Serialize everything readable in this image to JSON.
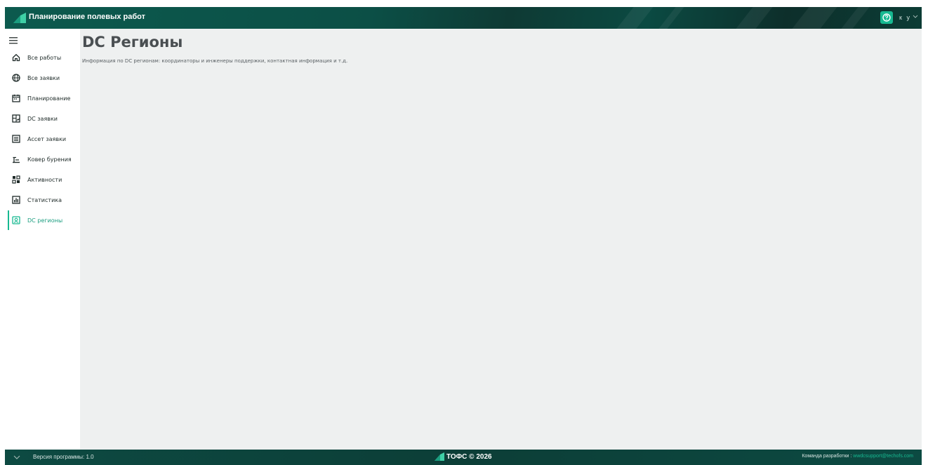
{
  "header": {
    "app_title": "Планирование полевых работ",
    "user_initials": "к у",
    "help_icon": "help-circle-icon",
    "brand_color": "#0c4f46",
    "accent_color": "#17b991"
  },
  "sidebar": {
    "menu_icon": "hamburger-icon",
    "items": [
      {
        "label": "Все работы",
        "icon": "home-icon"
      },
      {
        "label": "Все заявки",
        "icon": "globe-icon"
      },
      {
        "label": "Планирование",
        "icon": "calendar-icon"
      },
      {
        "label": "DC заявки",
        "icon": "chart-box-icon"
      },
      {
        "label": "Ассет заявки",
        "icon": "list-box-icon"
      },
      {
        "label": "Ковер бурения",
        "icon": "drill-icon"
      },
      {
        "label": "Активности",
        "icon": "grid-icon"
      },
      {
        "label": "Статистика",
        "icon": "bar-chart-icon"
      },
      {
        "label": "DC регионы",
        "icon": "region-icon",
        "active": true
      }
    ]
  },
  "main": {
    "title": "DC Регионы",
    "description": "Информация по DC регионам: координаторы и инженеры поддержки, контактная информация и т.д."
  },
  "footer": {
    "version": "Версия программы: 1.0",
    "brand": "ТОФС © 2026",
    "dev_team_label": "Команда разработки : ",
    "dev_team_email": "wwdcsupport@techofs.com"
  }
}
